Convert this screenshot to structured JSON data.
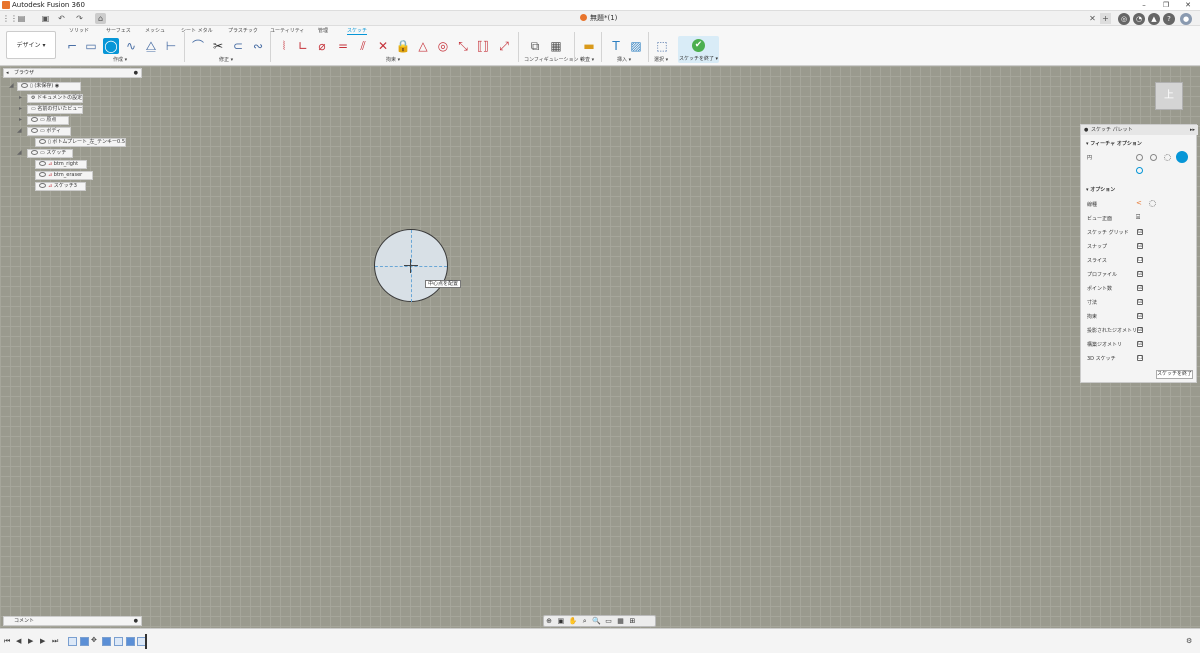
{
  "app": {
    "title": "Autodesk Fusion 360"
  },
  "document": {
    "tab_title": "無題*(1)"
  },
  "ribbon": {
    "workspace": "デザイン ▾",
    "tabs": [
      "ソリッド",
      "サーフェス",
      "メッシュ",
      "シート メタル",
      "プラスチック",
      "ユーティリティ",
      "管理",
      "スケッチ"
    ],
    "active_tab": "スケッチ",
    "groups": {
      "create": "作成 ▾",
      "modify": "修正 ▾",
      "constraints": "拘束 ▾",
      "configure": "コンフィギュレーション ▾",
      "inspect": "検査 ▾",
      "insert": "挿入 ▾",
      "select": "選択 ▾",
      "finish": "スケッチを終了 ▾"
    }
  },
  "browser": {
    "title": "ブラウザ",
    "root": "(未保存)",
    "items": {
      "doc_settings": "ドキュメントの設定",
      "named_views": "名前の付いたビュー",
      "origin": "原点",
      "bodies": "ボディ",
      "body1": "ボトムプレート_左_テンキー0.5",
      "sketches": "スケッチ",
      "sk1": "btm_right",
      "sk2": "btm_eraser",
      "sk3": "スケッチ3"
    }
  },
  "canvas": {
    "tooltip": "中心点を配置"
  },
  "viewcube": {
    "face": "上"
  },
  "palette": {
    "title": "スケッチ パレット",
    "feature_options": "フィーチャ オプション",
    "circle_label": "円",
    "options_label": "オプション",
    "rows": {
      "linetype": "線種",
      "look_at": "ビュー正面",
      "grid": "スケッチ グリッド",
      "snap": "スナップ",
      "slice": "スライス",
      "profile": "プロファイル",
      "points": "ポイント数",
      "dimensions": "寸法",
      "constraints": "拘束",
      "projected": "投影されたジオメトリ",
      "construction": "構築ジオメトリ",
      "sketch3d": "3D スケッチ"
    },
    "checked": {
      "grid": "☑",
      "snap": "☑",
      "slice": "☐",
      "profile": "☑",
      "points": "☑",
      "dimensions": "☑",
      "constraints": "☑",
      "projected": "☑",
      "construction": "☑",
      "sketch3d": "☐"
    },
    "finish": "スケッチを終了"
  },
  "comments": {
    "title": "コメント"
  },
  "colors": {
    "accent": "#0696d7",
    "body_fill": "#d8e0e6",
    "grid_bg": "#9a9a8e"
  }
}
